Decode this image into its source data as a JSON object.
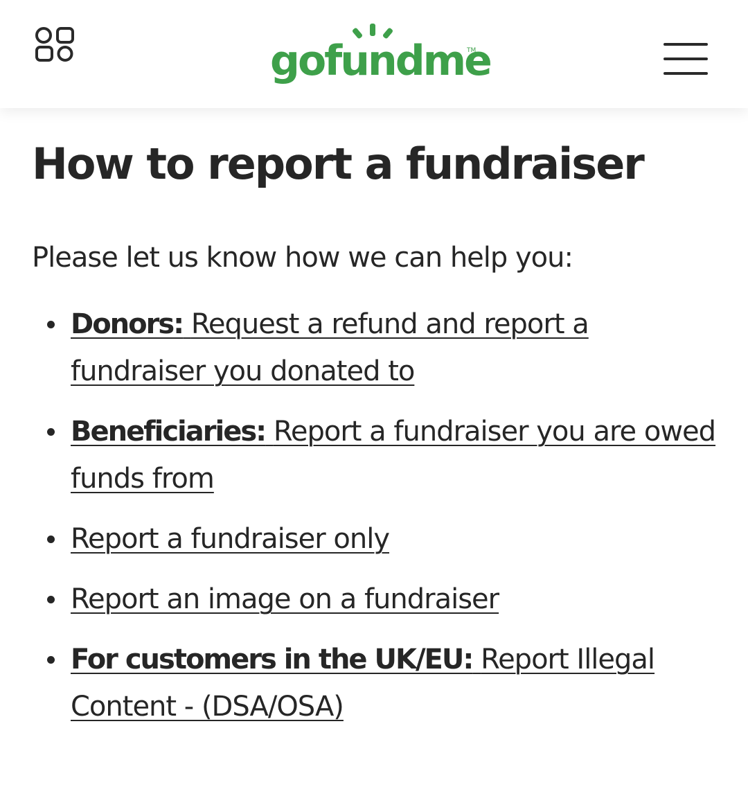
{
  "header": {
    "logo_text": "gofundme",
    "logo_tm": "TM",
    "brand_color": "#3ea04a",
    "apps_icon": "apps-grid-icon",
    "menu_icon": "hamburger-menu-icon"
  },
  "main": {
    "title": "How to report a fundraiser",
    "intro": "Please let us know how we can help you:",
    "options": [
      {
        "prefix": "Donors:",
        "link": "Request a refund and report a fundraiser you donated to"
      },
      {
        "prefix": "Beneficiaries:",
        "link": "Report a fundraiser you are owed funds from"
      },
      {
        "prefix": "",
        "link": "Report a fundraiser only"
      },
      {
        "prefix": "",
        "link": "Report an image on a fundraiser"
      },
      {
        "prefix": "For customers in the UK/EU:",
        "link": "Report Illegal Content - (DSA/OSA)"
      }
    ]
  }
}
